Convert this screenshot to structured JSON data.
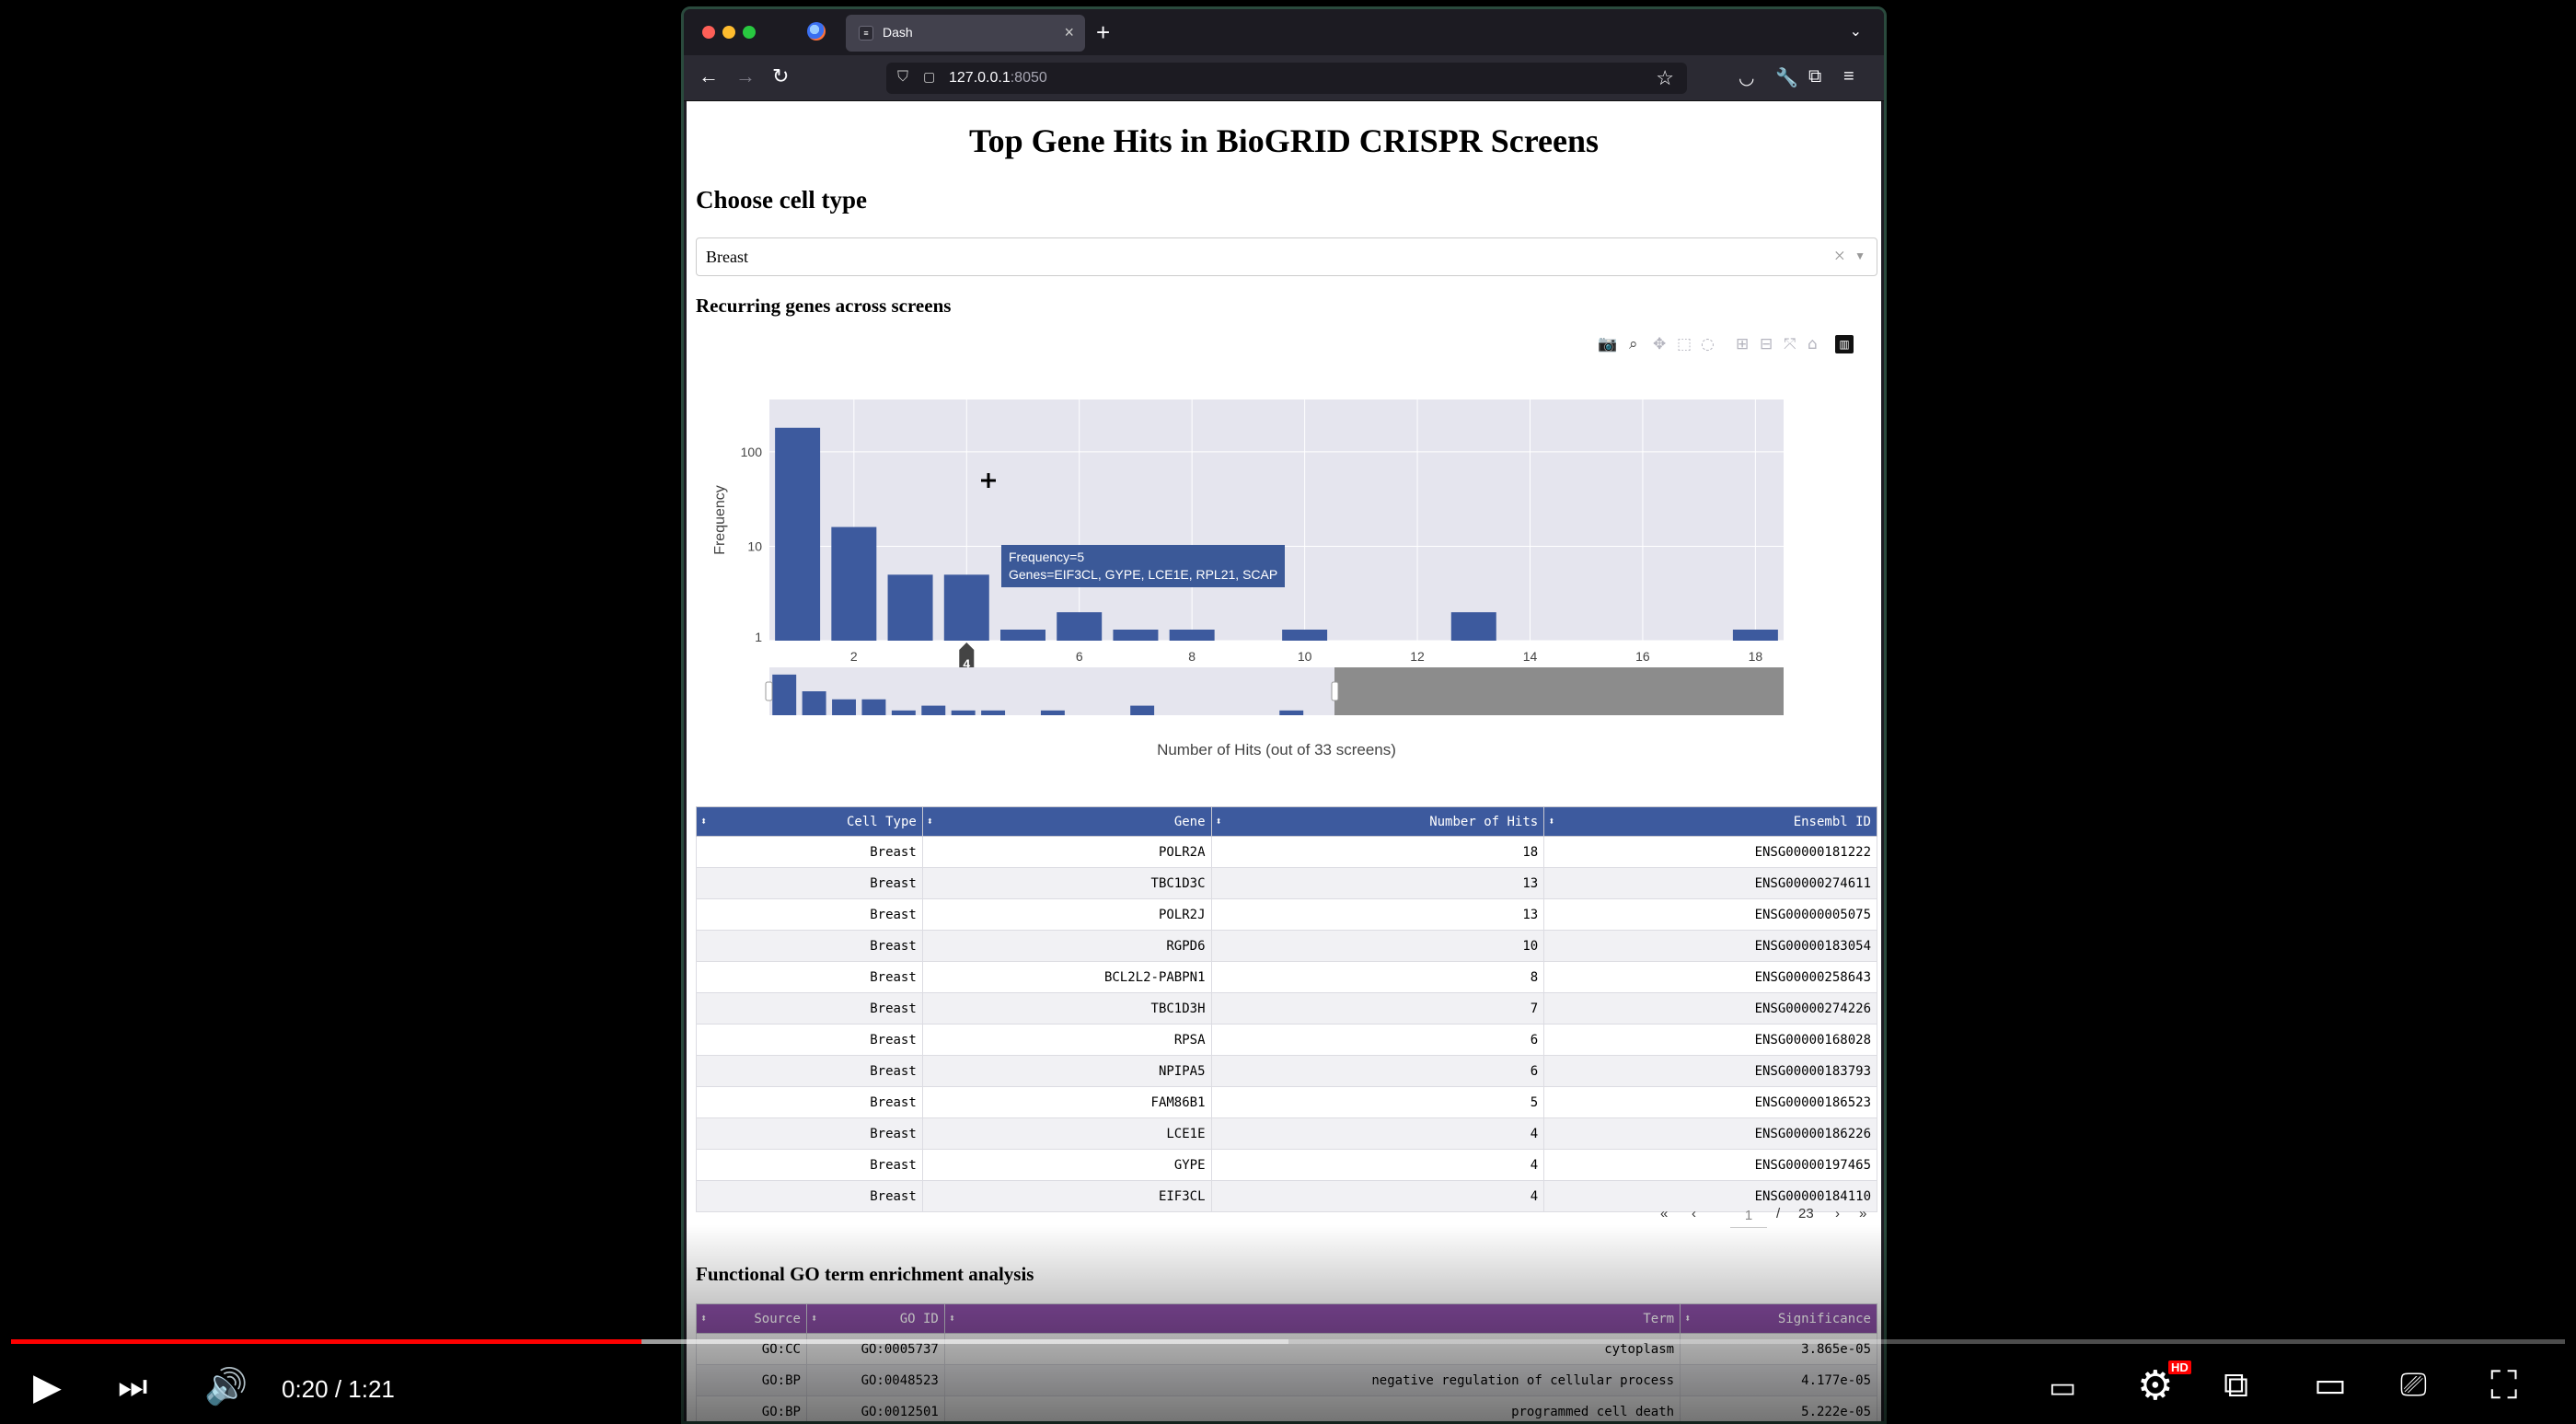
{
  "browser": {
    "tab_title": "Dash",
    "url_host": "127.0.0.1",
    "url_port": ":8050"
  },
  "page": {
    "title": "Top Gene Hits in BioGRID CRISPR Screens",
    "cell_heading": "Choose cell type",
    "dropdown_value": "Breast",
    "plot_heading": "Recurring genes across screens",
    "go_heading": "Functional GO term enrichment analysis"
  },
  "chart_data": {
    "type": "bar",
    "xlabel": "Number of Hits (out of 33 screens)",
    "ylabel": "Frequency",
    "yscale": "log",
    "xlim": [
      1,
      18.5
    ],
    "ylim_log": [
      1,
      300
    ],
    "x_ticks": [
      2,
      4,
      6,
      8,
      10,
      12,
      14,
      16,
      18
    ],
    "y_ticks": [
      1,
      10,
      100
    ],
    "x": [
      1,
      2,
      3,
      4,
      5,
      6,
      7,
      8,
      10,
      13,
      18
    ],
    "values": [
      180,
      16,
      5,
      5,
      1,
      2,
      1,
      1,
      1,
      2,
      1
    ],
    "hover_label": "4",
    "tooltip": {
      "line1": "Frequency=5",
      "line2": "Genes=EIF3CL, GYPE, LCE1E, RPL21, SCAP"
    },
    "rangeslider": true,
    "colors": {
      "bar": "#3d5a9e",
      "plot_bg": "#e5e5ee",
      "range_mask": "#8c8c8c"
    }
  },
  "gene_table": {
    "headers": [
      "Cell Type",
      "Gene",
      "Number of Hits",
      "Ensembl ID"
    ],
    "rows": [
      [
        "Breast",
        "POLR2A",
        "18",
        "ENSG00000181222"
      ],
      [
        "Breast",
        "TBC1D3C",
        "13",
        "ENSG00000274611"
      ],
      [
        "Breast",
        "POLR2J",
        "13",
        "ENSG00000005075"
      ],
      [
        "Breast",
        "RGPD6",
        "10",
        "ENSG00000183054"
      ],
      [
        "Breast",
        "BCL2L2-PABPN1",
        "8",
        "ENSG00000258643"
      ],
      [
        "Breast",
        "TBC1D3H",
        "7",
        "ENSG00000274226"
      ],
      [
        "Breast",
        "RPSA",
        "6",
        "ENSG00000168028"
      ],
      [
        "Breast",
        "NPIPA5",
        "6",
        "ENSG00000183793"
      ],
      [
        "Breast",
        "FAM86B1",
        "5",
        "ENSG00000186523"
      ],
      [
        "Breast",
        "LCE1E",
        "4",
        "ENSG00000186226"
      ],
      [
        "Breast",
        "GYPE",
        "4",
        "ENSG00000197465"
      ],
      [
        "Breast",
        "EIF3CL",
        "4",
        "ENSG00000184110"
      ]
    ],
    "page_current": "1",
    "page_separator": "/",
    "page_total": "23"
  },
  "go_table": {
    "headers": [
      "Source",
      "GO ID",
      "Term",
      "Significance"
    ],
    "rows": [
      [
        "GO:CC",
        "GO:0005737",
        "cytoplasm",
        "3.865e-05"
      ],
      [
        "GO:BP",
        "GO:0048523",
        "negative regulation of cellular process",
        "4.177e-05"
      ],
      [
        "GO:BP",
        "GO:0012501",
        "programmed cell death",
        "5.222e-05"
      ]
    ]
  },
  "player": {
    "time": "0:20 / 1:21",
    "hd_badge": "HD",
    "played_fraction": 0.247,
    "buffered_fraction": 0.5
  }
}
